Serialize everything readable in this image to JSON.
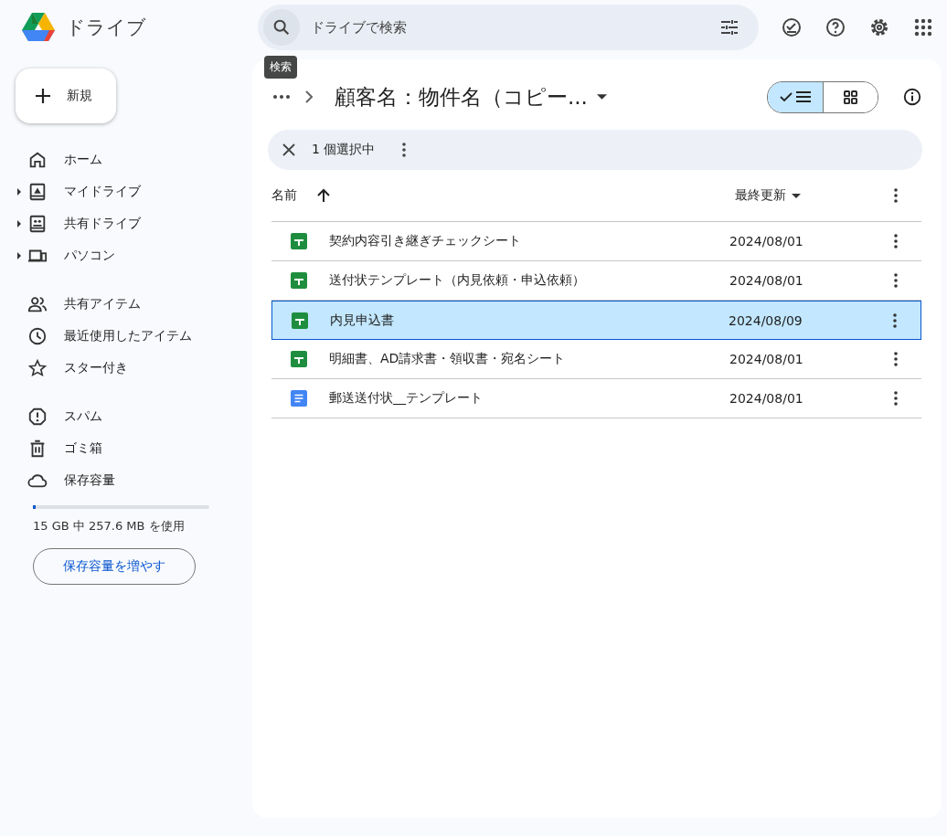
{
  "app": {
    "name": "ドライブ"
  },
  "search": {
    "placeholder": "ドライブで検索",
    "tooltip": "検索"
  },
  "new_button": {
    "label": "新規"
  },
  "sidebar": {
    "groups": [
      [
        {
          "label": "ホーム",
          "expandable": false
        },
        {
          "label": "マイドライブ",
          "expandable": true
        },
        {
          "label": "共有ドライブ",
          "expandable": true
        },
        {
          "label": "パソコン",
          "expandable": true
        }
      ],
      [
        {
          "label": "共有アイテム",
          "expandable": false
        },
        {
          "label": "最近使用したアイテム",
          "expandable": false
        },
        {
          "label": "スター付き",
          "expandable": false
        }
      ],
      [
        {
          "label": "スパム",
          "expandable": false
        },
        {
          "label": "ゴミ箱",
          "expandable": false
        },
        {
          "label": "保存容量",
          "expandable": false
        }
      ]
    ]
  },
  "storage": {
    "level": 0.017,
    "usage": "15 GB 中 257.6 MB を使用",
    "button": "保存容量を増やす"
  },
  "breadcrumb": {
    "title": "顧客名：物件名（コピー..."
  },
  "view_toggle": [
    {
      "kind": "list",
      "selected": true
    },
    {
      "kind": "grid",
      "selected": false
    }
  ],
  "selection_bar": {
    "count": "1 個選択中"
  },
  "table": {
    "columns": [
      "名前",
      "最終更新"
    ],
    "rows": [
      {
        "kind": "sheet",
        "name": "契約内容引き継ぎチェックシート",
        "modified": "2024/08/01",
        "selected": false
      },
      {
        "kind": "sheet",
        "name": "送付状テンプレート（内見依頼・申込依頼）",
        "modified": "2024/08/01",
        "selected": false
      },
      {
        "kind": "sheet",
        "name": "内見申込書",
        "modified": "2024/08/09",
        "selected": true
      },
      {
        "kind": "sheet",
        "name": "明細書、AD請求書・領収書・宛名シート",
        "modified": "2024/08/01",
        "selected": false
      },
      {
        "kind": "doc",
        "name": "郵送送付状__テンプレート",
        "modified": "2024/08/01",
        "selected": false
      }
    ]
  }
}
